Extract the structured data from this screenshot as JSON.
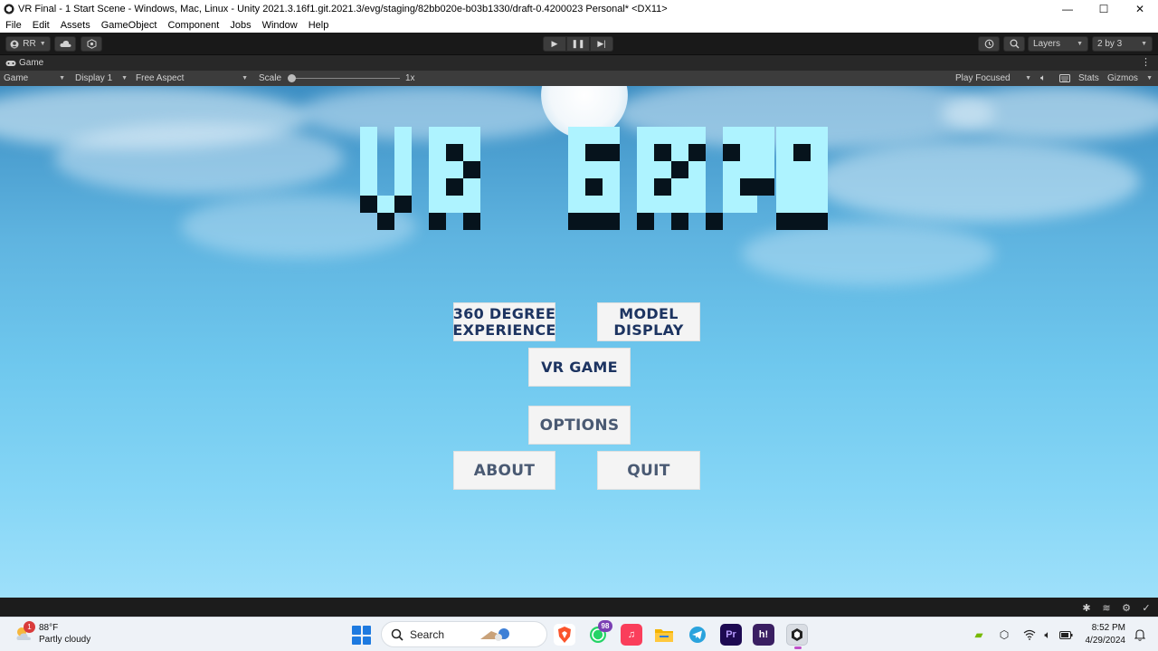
{
  "window": {
    "title": "VR Final - 1 Start Scene - Windows, Mac, Linux - Unity 2021.3.16f1.git.2021.3/evg/staging/82bb020e-b03b1330/draft-0.4200023 Personal* <DX11>",
    "controls": {
      "minimize": "—",
      "maximize": "☐",
      "close": "✕"
    }
  },
  "menubar": [
    "File",
    "Edit",
    "Assets",
    "GameObject",
    "Component",
    "Jobs",
    "Window",
    "Help"
  ],
  "toolbar": {
    "account_label": "RR",
    "layers_label": "Layers",
    "layout_label": "2 by 3"
  },
  "game_tab": {
    "label": "Game"
  },
  "game_controls": {
    "view_mode": "Game",
    "display": "Display 1",
    "aspect": "Free Aspect",
    "scale_label": "Scale",
    "scale_value": "1x",
    "play_mode": "Play Focused",
    "stats": "Stats",
    "gizmos": "Gizmos"
  },
  "game": {
    "title_text": "VR EXPO",
    "buttons": {
      "degree360_line1": "360 DEGREE",
      "degree360_line2": "EXPERIENCE",
      "model_line1": "MODEL",
      "model_line2": "DISPLAY",
      "vr_game": "VR GAME",
      "options": "OPTIONS",
      "about": "ABOUT",
      "quit": "QUIT"
    }
  },
  "taskbar": {
    "weather_temp": "88°F",
    "weather_desc": "Partly cloudy",
    "weather_badge": "1",
    "search_placeholder": "Search",
    "whatsapp_badge": "98",
    "premiere_label": "Pr",
    "hive_label": "h!",
    "time": "8:52 PM",
    "date": "4/29/2024"
  },
  "colors": {
    "title_cyan": "#aef3ff",
    "title_dark": "#06131c",
    "button_text": "#1d3461",
    "button_text_light": "#4a5a73",
    "taskbar_bg": "#eef2f7"
  }
}
